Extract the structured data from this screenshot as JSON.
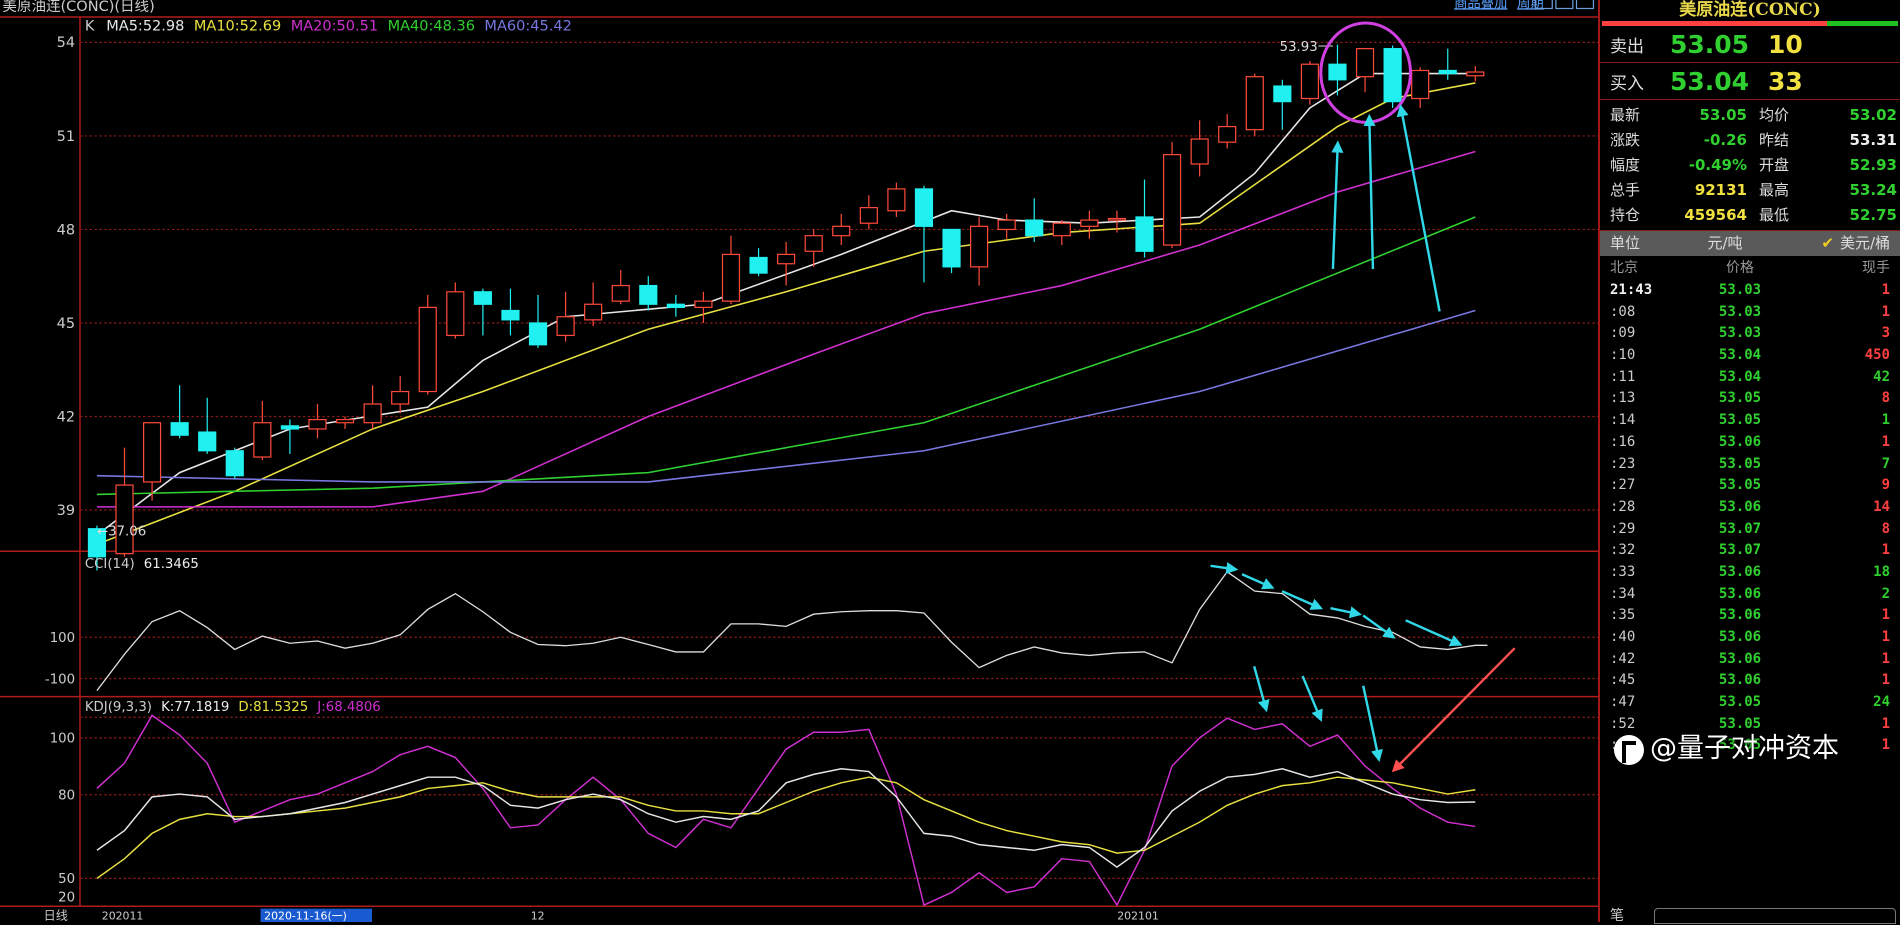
{
  "window": {
    "title": "美原油连(CONC)(日线)",
    "links": [
      "商品叠加",
      "周期"
    ]
  },
  "main": {
    "indicator_label": "K",
    "ma_labels": [
      {
        "text": "MA5:52.98",
        "color": "#e6e6e6"
      },
      {
        "text": "MA10:52.69",
        "color": "#e8e040"
      },
      {
        "text": "MA20:50.51",
        "color": "#d030d0"
      },
      {
        "text": "MA40:48.36",
        "color": "#30d030"
      },
      {
        "text": "MA60:45.42",
        "color": "#7878e0"
      }
    ],
    "high_marker": "53.93",
    "low_marker": "←37.06"
  },
  "cci": {
    "label": "CCI(14)",
    "value": "61.3465",
    "ticks": [
      "100",
      "-100"
    ]
  },
  "kdj": {
    "label": "KDJ(9,3,3)",
    "k": "K:77.1819",
    "d": "D:81.5325",
    "j": "J:68.4806",
    "ticks": [
      "100",
      "80",
      "50",
      "20"
    ]
  },
  "xaxis": {
    "period": "日线",
    "labels": [
      "202011",
      "12",
      "202101"
    ],
    "cursor_date": "2020-11-16(一)"
  },
  "chart_data": {
    "type": "candlestick",
    "title": "美原油连(CONC)(日线)",
    "y_ticks": [
      54,
      51,
      48,
      45,
      42,
      39
    ],
    "ylim": [
      36.5,
      54.6
    ],
    "colors": {
      "up": "#ff4a3a",
      "down": "#20f0f0"
    },
    "candles_ohlc": [
      [
        38.4,
        38.5,
        37.06,
        37.5
      ],
      [
        37.6,
        41.0,
        37.5,
        39.8
      ],
      [
        39.9,
        41.8,
        39.3,
        41.8
      ],
      [
        41.8,
        43.0,
        41.3,
        41.4
      ],
      [
        41.5,
        42.6,
        40.8,
        40.9
      ],
      [
        40.9,
        41.0,
        40.0,
        40.1
      ],
      [
        40.7,
        42.5,
        40.6,
        41.8
      ],
      [
        41.7,
        41.9,
        40.8,
        41.6
      ],
      [
        41.6,
        42.4,
        41.3,
        41.9
      ],
      [
        41.8,
        42.0,
        41.6,
        41.9
      ],
      [
        41.8,
        43.0,
        41.6,
        42.4
      ],
      [
        42.4,
        43.3,
        42.1,
        42.8
      ],
      [
        42.8,
        45.9,
        42.7,
        45.5
      ],
      [
        44.6,
        46.3,
        44.5,
        46.0
      ],
      [
        46.0,
        46.1,
        44.6,
        45.6
      ],
      [
        45.4,
        46.1,
        44.6,
        45.1
      ],
      [
        45.0,
        45.9,
        44.2,
        44.3
      ],
      [
        44.6,
        46.0,
        44.4,
        45.2
      ],
      [
        45.1,
        46.3,
        44.9,
        45.6
      ],
      [
        45.7,
        46.7,
        45.6,
        46.2
      ],
      [
        46.2,
        46.5,
        45.4,
        45.6
      ],
      [
        45.6,
        45.9,
        45.2,
        45.5
      ],
      [
        45.5,
        46.0,
        45.0,
        45.7
      ],
      [
        45.7,
        47.8,
        45.6,
        47.2
      ],
      [
        47.1,
        47.4,
        46.5,
        46.6
      ],
      [
        46.9,
        47.6,
        46.2,
        47.2
      ],
      [
        47.3,
        48.0,
        46.8,
        47.8
      ],
      [
        47.8,
        48.5,
        47.5,
        48.1
      ],
      [
        48.2,
        49.1,
        48.0,
        48.7
      ],
      [
        48.6,
        49.5,
        48.4,
        49.3
      ],
      [
        49.3,
        49.4,
        46.3,
        48.1
      ],
      [
        48.0,
        48.0,
        46.6,
        46.8
      ],
      [
        46.8,
        48.4,
        46.2,
        48.1
      ],
      [
        48.0,
        48.5,
        47.7,
        48.3
      ],
      [
        48.3,
        49.0,
        47.6,
        47.8
      ],
      [
        47.8,
        48.3,
        47.5,
        48.2
      ],
      [
        48.1,
        48.6,
        47.7,
        48.3
      ],
      [
        48.3,
        48.6,
        47.9,
        48.35
      ],
      [
        48.4,
        49.6,
        47.1,
        47.3
      ],
      [
        47.5,
        50.8,
        47.4,
        50.4
      ],
      [
        50.1,
        51.5,
        49.7,
        50.9
      ],
      [
        50.8,
        51.7,
        50.6,
        51.3
      ],
      [
        51.2,
        53.0,
        51.0,
        52.9
      ],
      [
        52.6,
        52.8,
        51.2,
        52.1
      ],
      [
        52.2,
        53.4,
        52.0,
        53.3
      ],
      [
        53.3,
        53.93,
        52.3,
        52.8
      ],
      [
        52.9,
        53.8,
        52.4,
        53.8
      ],
      [
        53.8,
        53.9,
        51.9,
        52.1
      ],
      [
        52.2,
        53.2,
        51.9,
        53.1
      ],
      [
        53.1,
        53.8,
        52.8,
        53.0
      ],
      [
        52.93,
        53.24,
        52.75,
        53.05
      ]
    ],
    "ma_series": [
      {
        "name": "MA5",
        "color": "#e6e6e6",
        "points": [
          [
            0,
            38.2
          ],
          [
            3,
            40.2
          ],
          [
            7,
            41.6
          ],
          [
            12,
            42.3
          ],
          [
            14,
            43.8
          ],
          [
            17,
            45.2
          ],
          [
            22,
            45.6
          ],
          [
            27,
            47.2
          ],
          [
            31,
            48.6
          ],
          [
            33,
            48.3
          ],
          [
            36,
            48.2
          ],
          [
            40,
            48.4
          ],
          [
            42,
            49.8
          ],
          [
            44,
            51.9
          ],
          [
            46,
            53.0
          ],
          [
            50,
            53.0
          ]
        ]
      },
      {
        "name": "MA10",
        "color": "#e8e040",
        "points": [
          [
            0,
            37.9
          ],
          [
            5,
            39.6
          ],
          [
            10,
            41.6
          ],
          [
            14,
            42.8
          ],
          [
            20,
            44.8
          ],
          [
            25,
            46.0
          ],
          [
            30,
            47.3
          ],
          [
            35,
            47.9
          ],
          [
            40,
            48.2
          ],
          [
            45,
            51.3
          ],
          [
            47,
            52.2
          ],
          [
            50,
            52.7
          ]
        ]
      },
      {
        "name": "MA20",
        "color": "#d030d0",
        "points": [
          [
            0,
            39.1
          ],
          [
            10,
            39.1
          ],
          [
            14,
            39.6
          ],
          [
            20,
            42.0
          ],
          [
            26,
            44.0
          ],
          [
            30,
            45.3
          ],
          [
            35,
            46.2
          ],
          [
            40,
            47.5
          ],
          [
            45,
            49.2
          ],
          [
            50,
            50.5
          ]
        ]
      },
      {
        "name": "MA40",
        "color": "#30d030",
        "points": [
          [
            0,
            39.5
          ],
          [
            10,
            39.7
          ],
          [
            20,
            40.2
          ],
          [
            30,
            41.8
          ],
          [
            40,
            44.8
          ],
          [
            50,
            48.4
          ]
        ]
      },
      {
        "name": "MA60",
        "color": "#7878e0",
        "points": [
          [
            0,
            40.1
          ],
          [
            10,
            39.9
          ],
          [
            20,
            39.9
          ],
          [
            30,
            40.9
          ],
          [
            40,
            42.8
          ],
          [
            50,
            45.4
          ]
        ]
      }
    ],
    "cci": [
      -159,
      18,
      176,
      229,
      147,
      41,
      106,
      71,
      82,
      47,
      71,
      112,
      235,
      312,
      224,
      124,
      65,
      59,
      71,
      100,
      65,
      29,
      29,
      165,
      165,
      153,
      212,
      224,
      229,
      229,
      218,
      76,
      -47,
      12,
      53,
      24,
      12,
      24,
      29,
      -24,
      235,
      418,
      324,
      312,
      212,
      194,
      153,
      124,
      53,
      41,
      61
    ],
    "kdj": {
      "K": [
        60,
        67,
        79,
        80,
        79,
        71,
        72,
        73,
        75,
        77,
        80,
        83,
        86,
        86,
        83,
        76,
        75,
        78,
        80,
        78,
        73,
        70,
        72,
        71,
        74,
        84,
        87,
        89,
        88,
        79,
        66,
        65,
        62,
        61,
        60,
        62,
        61,
        54,
        61,
        74,
        81,
        86,
        87,
        89,
        86,
        88,
        84,
        80,
        78,
        77,
        77.18
      ],
      "D": [
        50,
        57,
        66,
        71,
        73,
        72,
        72,
        73,
        74,
        75,
        77,
        79,
        82,
        83,
        84,
        81,
        79,
        79,
        79,
        79,
        76,
        74,
        74,
        73,
        73,
        77,
        81,
        84,
        86,
        84,
        78,
        74,
        70,
        67,
        65,
        63,
        62,
        59,
        60,
        65,
        70,
        76,
        80,
        83,
        84,
        86,
        85,
        84,
        82,
        80,
        81.53
      ],
      "J": [
        82,
        91,
        108,
        101,
        91,
        70,
        74,
        78,
        80,
        84,
        88,
        94,
        97,
        93,
        82,
        68,
        69,
        78,
        86,
        78,
        66,
        61,
        71,
        68,
        82,
        96,
        102,
        102,
        103,
        80,
        40,
        45,
        52,
        45,
        47,
        57,
        56,
        40,
        60,
        90,
        100,
        107,
        103,
        105,
        97,
        101,
        90,
        82,
        75,
        70,
        68.48
      ]
    }
  },
  "panel": {
    "title": "美原油连(CONC)",
    "sell": {
      "label": "卖出",
      "price": "53.05",
      "volume": "10"
    },
    "buy": {
      "label": "买入",
      "price": "53.04",
      "volume": "33"
    },
    "stats": [
      {
        "l": "最新",
        "v": "53.05",
        "vc": "#2fd02f",
        "l2": "均价",
        "v2": "53.02",
        "v2c": "#2fd02f"
      },
      {
        "l": "涨跌",
        "v": "-0.26",
        "vc": "#2fd02f",
        "l2": "昨结",
        "v2": "53.31",
        "v2c": "#eeeeee"
      },
      {
        "l": "幅度",
        "v": "-0.49%",
        "vc": "#2fd02f",
        "l2": "开盘",
        "v2": "52.93",
        "v2c": "#2fd02f"
      },
      {
        "l": "总手",
        "v": "92131",
        "vc": "#f0e040",
        "l2": "最高",
        "v2": "53.24",
        "v2c": "#2fd02f"
      },
      {
        "l": "持仓",
        "v": "459564",
        "vc": "#f0e040",
        "l2": "最低",
        "v2": "52.75",
        "v2c": "#2fd02f"
      }
    ],
    "unit": {
      "label": "单位",
      "opt1": "元/吨",
      "opt2": "美元/桶"
    },
    "trades_header": {
      "time": "北京",
      "price": "价格",
      "hand": "现手"
    },
    "trades": [
      {
        "t": "21:43",
        "p": "53.03",
        "h": "1",
        "c": "#ff4040"
      },
      {
        "t": ":08",
        "p": "53.03",
        "h": "1",
        "c": "#ff4040"
      },
      {
        "t": ":09",
        "p": "53.03",
        "h": "3",
        "c": "#ff4040"
      },
      {
        "t": ":10",
        "p": "53.04",
        "h": "450",
        "c": "#ff4040"
      },
      {
        "t": ":11",
        "p": "53.04",
        "h": "42",
        "c": "#2fd02f"
      },
      {
        "t": ":13",
        "p": "53.05",
        "h": "8",
        "c": "#ff4040"
      },
      {
        "t": ":14",
        "p": "53.05",
        "h": "1",
        "c": "#2fd02f"
      },
      {
        "t": ":16",
        "p": "53.06",
        "h": "1",
        "c": "#ff4040"
      },
      {
        "t": ":23",
        "p": "53.05",
        "h": "7",
        "c": "#2fd02f"
      },
      {
        "t": ":27",
        "p": "53.05",
        "h": "9",
        "c": "#ff4040"
      },
      {
        "t": ":28",
        "p": "53.06",
        "h": "14",
        "c": "#ff4040"
      },
      {
        "t": ":29",
        "p": "53.07",
        "h": "8",
        "c": "#ff4040"
      },
      {
        "t": ":32",
        "p": "53.07",
        "h": "1",
        "c": "#ff4040"
      },
      {
        "t": ":33",
        "p": "53.06",
        "h": "18",
        "c": "#2fd02f"
      },
      {
        "t": ":34",
        "p": "53.06",
        "h": "2",
        "c": "#2fd02f"
      },
      {
        "t": ":35",
        "p": "53.06",
        "h": "1",
        "c": "#ff4040"
      },
      {
        "t": ":40",
        "p": "53.06",
        "h": "1",
        "c": "#ff4040"
      },
      {
        "t": ":42",
        "p": "53.06",
        "h": "1",
        "c": "#ff4040"
      },
      {
        "t": ":45",
        "p": "53.06",
        "h": "1",
        "c": "#ff4040"
      },
      {
        "t": ":47",
        "p": "53.05",
        "h": "24",
        "c": "#2fd02f"
      },
      {
        "t": ":52",
        "p": "53.05",
        "h": "1",
        "c": "#ff4040"
      },
      {
        "t": ":55",
        "p": "53.05",
        "h": "1",
        "c": "#ff4040"
      }
    ],
    "bottom_label": "笔"
  },
  "watermark": "@量子对冲资本"
}
